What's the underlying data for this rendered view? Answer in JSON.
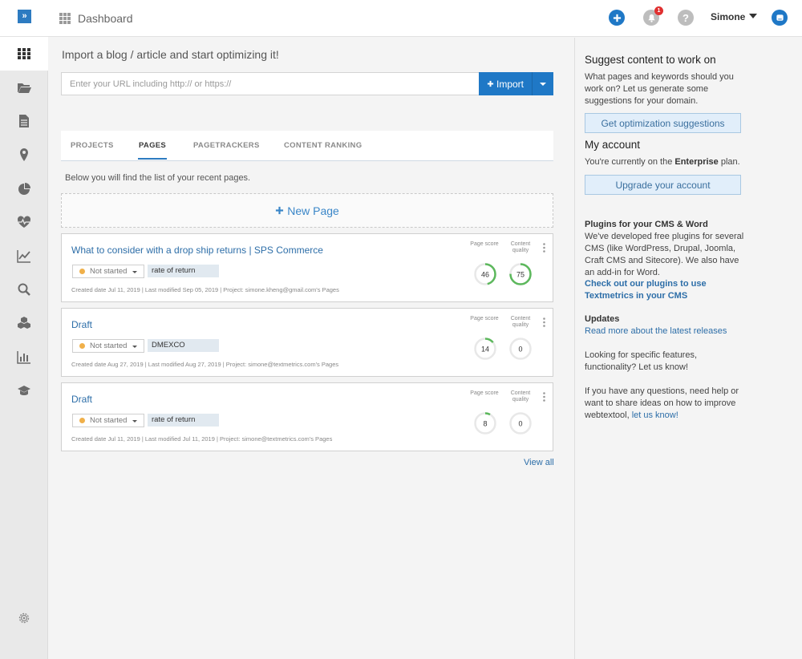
{
  "topbar": {
    "title": "Dashboard",
    "user_name": "Simone",
    "notification_count": "1"
  },
  "sidebar": {
    "items": [
      "dashboard",
      "projects",
      "documents",
      "locations",
      "reports",
      "health",
      "analytics",
      "search",
      "components",
      "statistics",
      "academy",
      "settings"
    ]
  },
  "import": {
    "title": "Import a blog / article and start optimizing it!",
    "placeholder": "Enter your URL including http:// or https://",
    "button_label": "Import"
  },
  "tabs": [
    "PROJECTS",
    "PAGES",
    "PAGETRACKERS",
    "CONTENT RANKING"
  ],
  "active_tab": "PAGES",
  "recent_text": "Below you will find the list of your recent pages.",
  "new_page_label": "New Page",
  "score_labels": {
    "page_score": "Page score",
    "content_quality": "Content quality"
  },
  "pages": [
    {
      "title": "What to consider with a drop ship returns | SPS Commerce",
      "status": "Not started",
      "tag": "rate of return",
      "meta": "Created date Jul 11, 2019   |   Last modified Sep 05, 2019   |   Project: simone.kheng@gmail.com's Pages",
      "page_score": "46",
      "content_quality": "75"
    },
    {
      "title": "Draft",
      "status": "Not started",
      "tag": "DMEXCO",
      "meta": "Created date Aug 27, 2019   |   Last modified Aug 27, 2019   |   Project: simone@textmetrics.com's Pages",
      "page_score": "14",
      "content_quality": "0"
    },
    {
      "title": "Draft",
      "status": "Not started",
      "tag": "rate of return",
      "meta": "Created date Jul 11, 2019   |   Last modified Jul 11, 2019   |   Project: simone@textmetrics.com's Pages",
      "page_score": "8",
      "content_quality": "0"
    }
  ],
  "view_all": "View all",
  "right": {
    "suggest_title": "Suggest content to work on",
    "suggest_text": "What pages and keywords should you work on? Let us generate some suggestions for your domain.",
    "suggest_button": "Get optimization suggestions",
    "account_title": "My account",
    "account_text_pre": "You're currently on the ",
    "account_plan": "Enterprise",
    "account_text_post": " plan.",
    "upgrade_button": "Upgrade your account",
    "plugins_title": "Plugins for your CMS & Word",
    "plugins_text": "We've developed free plugins for several CMS (like WordPress, Drupal, Joomla, Craft CMS and Sitecore). We also have an add-in for Word.",
    "plugins_link": "Check out our plugins to use Textmetrics in your CMS",
    "updates_title": "Updates",
    "updates_link": "Read more about the latest releases",
    "features_text": "Looking for specific features, functionality? Let us know!",
    "help_text": "If you have any questions, need help or want to share ideas on how to improve webtextool, ",
    "help_link": "let us know!"
  },
  "colors": {
    "accent": "#1f78c6",
    "link": "#2d6ea8",
    "ring_green": "#5cb85c",
    "status_dot": "#f0b04a"
  }
}
